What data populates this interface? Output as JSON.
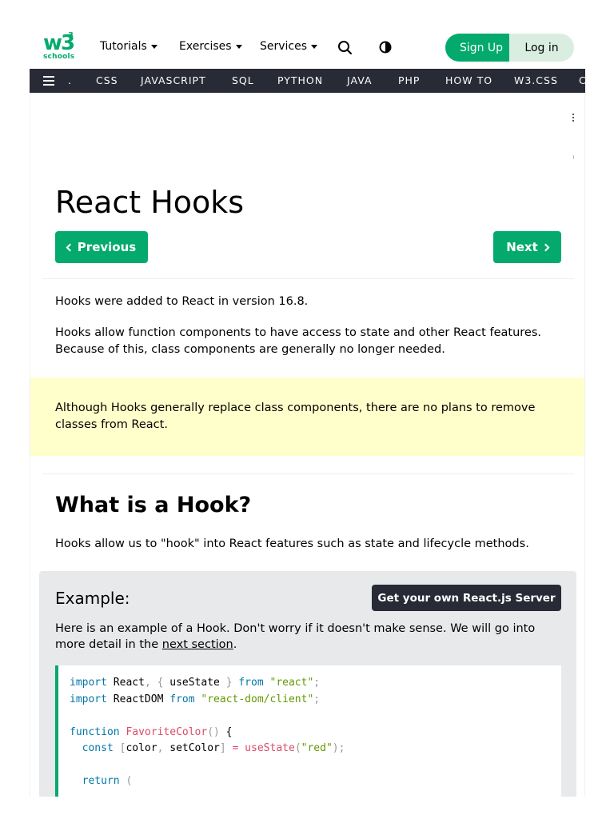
{
  "header": {
    "logo_main": "w3",
    "logo_sup": "3",
    "logo_sub": "schools",
    "menus": [
      "Tutorials",
      "Exercises",
      "Services"
    ],
    "signup_label": "Sign Up",
    "login_label": "Log in"
  },
  "topnav": {
    "items": [
      ".",
      "CSS",
      "JAVASCRIPT",
      "SQL",
      "PYTHON",
      "JAVA",
      "PHP",
      "HOW TO",
      "W3.CSS",
      "C"
    ]
  },
  "page": {
    "title": "React Hooks",
    "prev_label": "Previous",
    "next_label": "Next",
    "intro1": "Hooks were added to React in version 16.8.",
    "intro2": "Hooks allow function components to have access to state and other React features. Because of this, class components are generally no longer needed.",
    "note": "Although Hooks generally replace class components, there are no plans to remove classes from React.",
    "section_title": "What is a Hook?",
    "section_text": "Hooks allow us to \"hook\" into React features such as state and lifecycle methods."
  },
  "example": {
    "title": "Example:",
    "server_button": "Get your own React.js Server",
    "text_before": "Here is an example of a Hook. Don't worry if it doesn't make sense. We will go into more detail in the ",
    "link": "next section",
    "text_after": ".",
    "code": {
      "l1_kw": "import",
      "l1_a": " React",
      "l1_p1": ",",
      "l1_b1": " {",
      "l1_c": " useState ",
      "l1_b2": "}",
      "l1_from": " from",
      "l1_str": " \"react\"",
      "l1_end": ";",
      "l2_kw": "import",
      "l2_a": " ReactDOM",
      "l2_from": " from",
      "l2_str": " \"react-dom/client\"",
      "l2_end": ";",
      "l4_kw": "function",
      "l4_fn": " FavoriteColor",
      "l4_p": "()",
      "l4_b": " {",
      "l5_kw": "const",
      "l5_b1": " [",
      "l5_a": "color",
      "l5_c": ",",
      "l5_b": " setColor",
      "l5_b2": "]",
      "l5_eq": " =",
      "l5_fn": " useState",
      "l5_p1": "(",
      "l5_str": "\"red\"",
      "l5_p2": ")",
      "l5_end": ";",
      "l7_kw": "return",
      "l7_p": " ("
    }
  },
  "colors": {
    "brand_green": "#04AA6D",
    "dark_nav": "#282A35",
    "note_bg": "#FFFFCC",
    "example_bg": "#E7E9EB"
  }
}
